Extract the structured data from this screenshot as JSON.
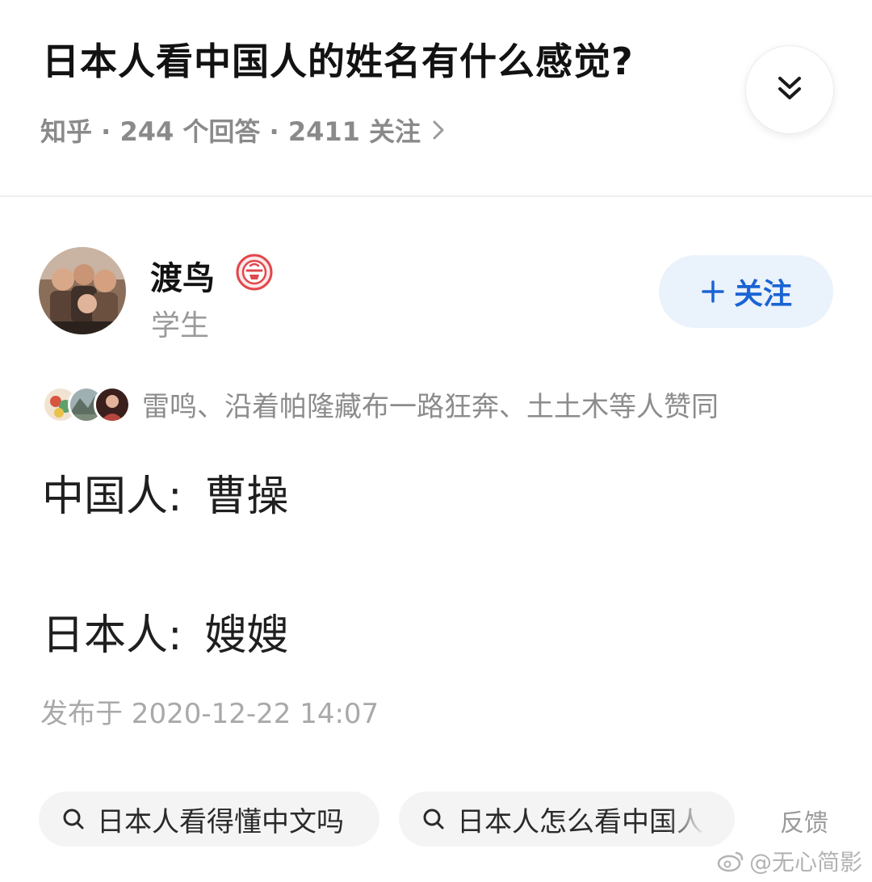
{
  "question": {
    "title": "日本人看中国人的姓名有什么感觉?",
    "meta": "知乎 · 244 个回答 · 2411 关注"
  },
  "author": {
    "name": "渡鸟",
    "role": "学生",
    "follow_label": "关注"
  },
  "endorsement": {
    "text": "雷鸣、沿着帕隆藏布一路狂奔、土土木等人赞同"
  },
  "answer": {
    "lines": [
      {
        "speaker": "中国人:",
        "content": "曹操"
      },
      {
        "speaker": "日本人:",
        "content": "嫂嫂"
      }
    ],
    "published": "发布于 2020-12-22 14:07"
  },
  "related_searches": [
    {
      "label": "日本人看得懂中文吗"
    },
    {
      "label": "日本人怎么看中国人"
    }
  ],
  "feedback_label": "反馈",
  "watermark": "@无心简影",
  "icons": {
    "collapse": "double-chevron-down-icon",
    "meta_arrow": "chevron-right-icon",
    "badge": "creator-badge-icon",
    "search": "search-icon"
  },
  "colors": {
    "accent": "#1a64d4",
    "follow_bg": "#eaf2fc",
    "muted": "#8a8a8a",
    "chip_bg": "#f4f4f5"
  }
}
